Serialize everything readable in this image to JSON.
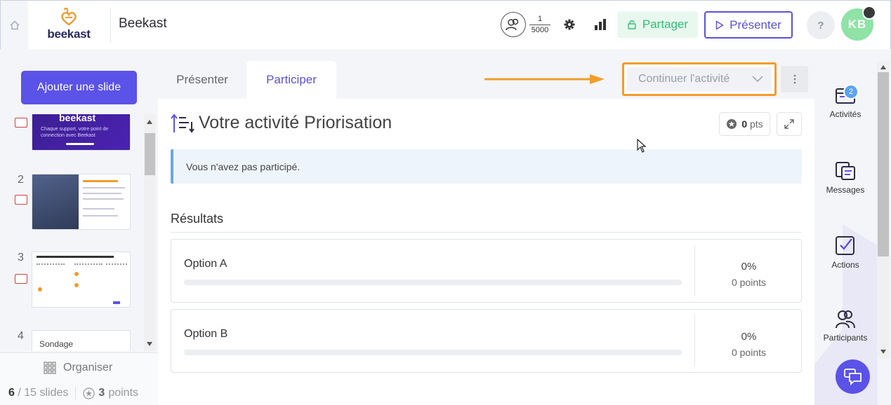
{
  "header": {
    "logo_text": "beekast",
    "app_title": "Beekast",
    "participants_current": "1",
    "participants_max": "5000",
    "share_label": "Partager",
    "present_label": "Présenter",
    "help_label": "?",
    "avatar_initials": "KB"
  },
  "sidebar_left": {
    "add_slide_label": "Ajouter une slide",
    "slides": [
      {
        "num": "",
        "thumb_title": "beekast",
        "thumb_sub": "Chaque support, votre point de connection avec Beekast"
      },
      {
        "num": "2"
      },
      {
        "num": "3"
      },
      {
        "num": "4",
        "thumb_title": "Sondage"
      }
    ],
    "organise_label": "Organiser",
    "slides_current": "6",
    "slides_total": "/ 15 slides",
    "points_value": "3",
    "points_label": "points"
  },
  "main": {
    "tabs": [
      {
        "label": "Présenter"
      },
      {
        "label": "Participer"
      }
    ],
    "continue_label": "Continuer l'activité",
    "activity_title": "Votre activité Priorisation",
    "points_value": "0",
    "points_unit": "pts",
    "notice_text": "Vous n'avez pas participé.",
    "results_title": "Résultats",
    "options": [
      {
        "label": "Option A",
        "percent_text": "0%",
        "points_text": "0 points",
        "fill_fraction": 0
      },
      {
        "label": "Option B",
        "percent_text": "0%",
        "points_text": "0 points",
        "fill_fraction": 0
      }
    ]
  },
  "sidebar_right": {
    "items": [
      {
        "label": "Activités",
        "icon": "activities-icon"
      },
      {
        "label": "Messages",
        "icon": "messages-icon"
      },
      {
        "label": "Actions",
        "icon": "actions-icon"
      },
      {
        "label": "Participants",
        "icon": "participants-icon"
      }
    ],
    "activities_badge": "2"
  },
  "colors": {
    "brand_purple": "#5b52e8",
    "share_green": "#2ebf71",
    "highlight_orange": "#f29c2b",
    "notice_blue": "#6aa7e8"
  }
}
